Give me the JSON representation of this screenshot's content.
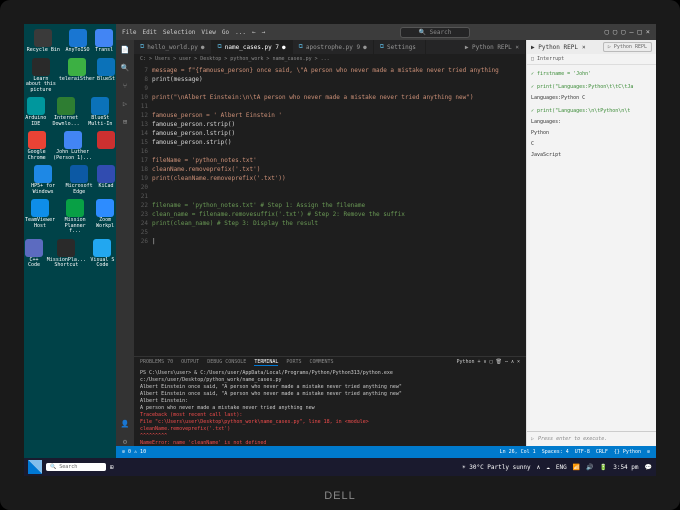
{
  "brand": "DELL",
  "desktop": {
    "rows": [
      [
        {
          "label": "Recycle Bin",
          "c": "#3a3a3a"
        },
        {
          "label": "AnyToISO",
          "c": "#1976d2"
        },
        {
          "label": "Transl",
          "c": "#4285f4"
        }
      ],
      [
        {
          "label": "Learn about this picture",
          "c": "#2a2a2a"
        },
        {
          "label": "teleraiSther",
          "c": "#3cb043"
        },
        {
          "label": "BlueSt",
          "c": "#0b72b9"
        }
      ],
      [
        {
          "label": "Arduino IDE",
          "c": "#00979d"
        },
        {
          "label": "Internet Downlo...",
          "c": "#2e7d32"
        },
        {
          "label": "BlueSt Multi-In",
          "c": "#0b72b9"
        }
      ],
      [
        {
          "label": "Google Chrome",
          "c": "#ea4335"
        },
        {
          "label": "John Luther (Person 1)...",
          "c": "#4285f4"
        },
        {
          "label": "",
          "c": "#cc3030"
        }
      ],
      [
        {
          "label": "HP5+ for Windows",
          "c": "#1e88e5"
        },
        {
          "label": "Microsoft Edge",
          "c": "#0c59a4"
        },
        {
          "label": "KiCad",
          "c": "#314cb0"
        }
      ],
      [
        {
          "label": "TeamViewer Host",
          "c": "#0e8ee9"
        },
        {
          "label": "Mission Planner f...",
          "c": "#08a045"
        },
        {
          "label": "Zoom Workpl",
          "c": "#2d8cff"
        }
      ],
      [
        {
          "label": "C++ Code",
          "c": "#5c6bc0"
        },
        {
          "label": "MissionPla... Shortcut",
          "c": "#2a2a2a"
        },
        {
          "label": "Visual S Code",
          "c": "#22a7f0"
        }
      ]
    ]
  },
  "vscode": {
    "menu": [
      "File",
      "Edit",
      "Selection",
      "View",
      "Go",
      "...",
      "←",
      "→"
    ],
    "search_placeholder": "Search",
    "tabs": [
      {
        "label": "hello_world.py",
        "active": false,
        "dot": "●"
      },
      {
        "label": "name_cases.py 7",
        "active": true,
        "dot": "●"
      },
      {
        "label": "apostrophe.py 9",
        "active": false,
        "dot": "●"
      },
      {
        "label": "Settings",
        "active": false,
        "dot": ""
      }
    ],
    "breadcrumbs": "C: > Users > user > Desktop > python_work > name_cases.py > ...",
    "code": [
      {
        "n": "7",
        "t": "message = f\"{famouse_person} once said, \\\"A person who never made a mistake never tried anything ",
        "cls": "cstr"
      },
      {
        "n": "8",
        "t": "print(message)",
        "cls": ""
      },
      {
        "n": "9",
        "t": "",
        "cls": ""
      },
      {
        "n": "10",
        "t": "print(\"\\nAlbert Einstein:\\n\\tA person who never made a mistake never tried anything new\")",
        "cls": "cstr"
      },
      {
        "n": "11",
        "t": "",
        "cls": ""
      },
      {
        "n": "12",
        "t": "famouse_person = ' Albert Einstein '",
        "cls": "cstr"
      },
      {
        "n": "13",
        "t": "famouse_person.rstrip()",
        "cls": ""
      },
      {
        "n": "14",
        "t": "famouse_person.lstrip()",
        "cls": ""
      },
      {
        "n": "15",
        "t": "famouse_person.strip()",
        "cls": ""
      },
      {
        "n": "16",
        "t": "",
        "cls": ""
      },
      {
        "n": "17",
        "t": "fileName = 'python_notes.txt'",
        "cls": "cstr"
      },
      {
        "n": "18",
        "t": "cleanName.removeprefix('.txt')",
        "cls": "cstr"
      },
      {
        "n": "19",
        "t": "print(cleanName.removeprefix('.txt'))",
        "cls": "cstr"
      },
      {
        "n": "20",
        "t": "",
        "cls": ""
      },
      {
        "n": "21",
        "t": "",
        "cls": ""
      },
      {
        "n": "22",
        "t": "filename = 'python_notes.txt'  # Step 1: Assign the filename",
        "cls": "ccom"
      },
      {
        "n": "23",
        "t": "clean_name = filename.removesuffix('.txt')  # Step 2: Remove the suffix",
        "cls": "ccom"
      },
      {
        "n": "24",
        "t": "print(clean_name)  # Step 3: Display the result",
        "cls": "ccom"
      },
      {
        "n": "25",
        "t": "",
        "cls": ""
      },
      {
        "n": "26",
        "t": "|",
        "cls": ""
      }
    ],
    "panel": {
      "tabs": [
        "PROBLEMS 70",
        "OUTPUT",
        "DEBUG CONSOLE",
        "TERMINAL",
        "PORTS",
        "COMMENTS"
      ],
      "active": 3,
      "shell_label": "Python + ∨  □ 🗑 ⋯ ∧ ×",
      "lines": [
        {
          "t": "PS C:\\Users\\user> & C:/Users/user/AppData/Local/Programs/Python/Python313/python.exe c:/Users/user/Desktop/python_work/name_cases.py",
          "cls": ""
        },
        {
          "t": "Albert Einstein once said, \"A person who never made a mistake never tried anything new\"",
          "cls": ""
        },
        {
          "t": "Albert Einstein once said, \"A person who never made a mistake never tried anything new\"",
          "cls": ""
        },
        {
          "t": "",
          "cls": ""
        },
        {
          "t": "Albert Einstein:",
          "cls": ""
        },
        {
          "t": "        A person who never made a mistake never tried anything new",
          "cls": ""
        },
        {
          "t": "Traceback (most recent call last):",
          "cls": "err"
        },
        {
          "t": "  File \"c:\\Users\\user\\Desktop\\python_work\\name_cases.py\", line 18, in <module>",
          "cls": "err"
        },
        {
          "t": "    cleanName.removeprefix('.txt')",
          "cls": "err"
        },
        {
          "t": "    ^^^^^^^^^",
          "cls": "err"
        },
        {
          "t": "NameError: name 'cleanName' is not defined",
          "cls": "err"
        },
        {
          "t": "PS C:\\Users\\user> |",
          "cls": ""
        }
      ]
    },
    "repl": {
      "title": "Python REPL",
      "btn": "Python REPL",
      "lines": [
        {
          "t": "✓ firstname = 'John'",
          "cls": "check"
        },
        {
          "t": " ",
          "cls": ""
        },
        {
          "t": "✓ print(\"Languages:Python\\t\\tC\\tJa",
          "cls": "check"
        },
        {
          "t": "Languages:Python        C",
          "cls": ""
        },
        {
          "t": " ",
          "cls": ""
        },
        {
          "t": "✓ print(\"Languages:\\n\\tPython\\n\\t",
          "cls": "check"
        },
        {
          "t": "Languages:",
          "cls": ""
        },
        {
          "t": "    Python",
          "cls": ""
        },
        {
          "t": "    C",
          "cls": ""
        },
        {
          "t": "    JavaScript",
          "cls": ""
        }
      ],
      "hint": "Press enter to execute."
    },
    "status": {
      "left": [
        "⊘ 0 ⚠ 10"
      ],
      "right": [
        "Ln 26, Col 1",
        "Spaces: 4",
        "UTF-8",
        "CRLF",
        "{} Python",
        "⊘"
      ]
    },
    "inline_right": "Interrupt"
  },
  "taskbar": {
    "search": "Search",
    "weather": "30°C Partly sunny",
    "time": "3:54 pm",
    "tray": [
      "⊘",
      "ENG",
      "📶",
      "🔊",
      "🔋"
    ]
  }
}
